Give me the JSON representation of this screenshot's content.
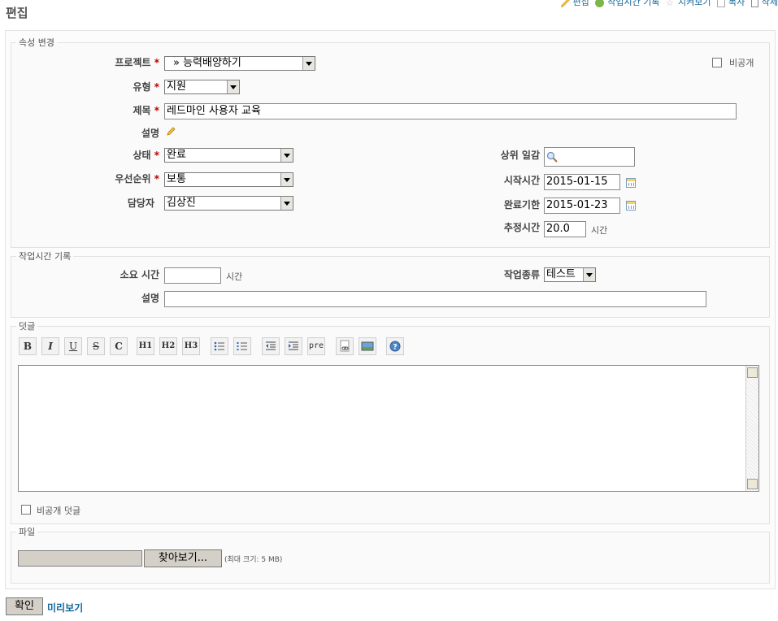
{
  "page_title": "편집",
  "top_actions": [
    "편집",
    "작업시간 기록",
    "지켜보기",
    "복사",
    "삭제"
  ],
  "attributes": {
    "legend": "속성 변경",
    "project": {
      "label": "프로젝트",
      "value": "» 능력배양하기"
    },
    "private": {
      "label": "비공개"
    },
    "tracker": {
      "label": "유형",
      "value": "지원"
    },
    "subject": {
      "label": "제목",
      "value": "레드마인 사용자 교육"
    },
    "description": {
      "label": "설명"
    },
    "status": {
      "label": "상태",
      "value": "완료"
    },
    "priority": {
      "label": "우선순위",
      "value": "보통"
    },
    "assignee": {
      "label": "담당자",
      "value": "김상진"
    },
    "parent": {
      "label": "상위 일감",
      "value": ""
    },
    "start_date": {
      "label": "시작시간",
      "value": "2015-01-15"
    },
    "due_date": {
      "label": "완료기한",
      "value": "2015-01-23"
    },
    "estimated": {
      "label": "추정시간",
      "value": "20.0",
      "unit": "시간"
    },
    "required_mark": "*"
  },
  "time_log": {
    "legend": "작업시간 기록",
    "spent": {
      "label": "소요 시간",
      "value": "",
      "unit": "시간"
    },
    "activity": {
      "label": "작업종류",
      "value": "테스트"
    },
    "comment": {
      "label": "설명",
      "value": ""
    }
  },
  "notes": {
    "legend": "덧글",
    "toolbar": [
      "B",
      "I",
      "U",
      "S",
      "C",
      "H1",
      "H2",
      "H3",
      "ul",
      "ol",
      "indent-left",
      "indent-right",
      "pre",
      "link",
      "image",
      "help"
    ],
    "pre_label": "pre",
    "private_notes": "비공개 덧글"
  },
  "files": {
    "legend": "파일",
    "browse": "찾아보기...",
    "max_size": "(최대 크기: 5 MB)"
  },
  "submit": "확인",
  "preview": "미리보기"
}
